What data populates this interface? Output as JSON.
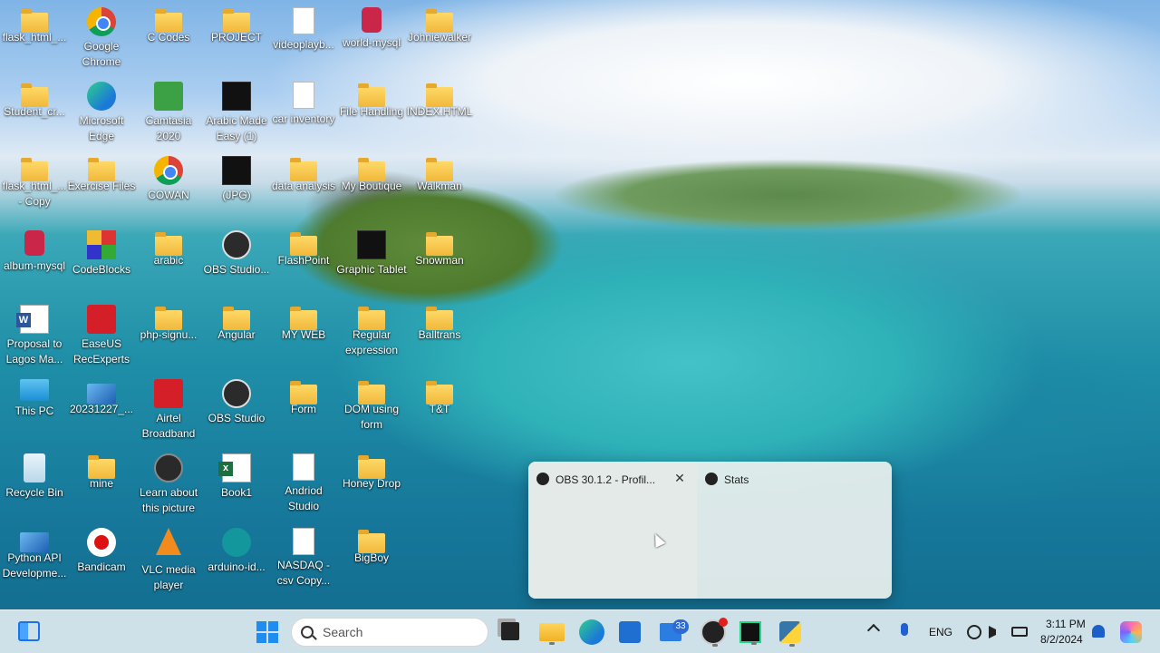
{
  "desktop": {
    "icons": [
      {
        "label": "flask_html_...",
        "icon": "folder-icon"
      },
      {
        "label": "Google Chrome",
        "icon": "chrome-icon"
      },
      {
        "label": "C Codes",
        "icon": "folder-icon"
      },
      {
        "label": "PROJECT",
        "icon": "folder-icon"
      },
      {
        "label": "videoplayb...",
        "icon": "file-icon"
      },
      {
        "label": "world-mysql",
        "icon": "database-icon"
      },
      {
        "label": "Johniewalker",
        "icon": "folder-icon"
      },
      {
        "label": "Student_cr...",
        "icon": "folder-icon"
      },
      {
        "label": "Microsoft Edge",
        "icon": "edge-icon"
      },
      {
        "label": "Camtasia 2020",
        "icon": "camtasia-icon"
      },
      {
        "label": "Arabic Made Easy (1)",
        "icon": "video-icon"
      },
      {
        "label": "car inventory",
        "icon": "file-icon"
      },
      {
        "label": "File Handling",
        "icon": "folder-icon"
      },
      {
        "label": "INDEX.HTML",
        "icon": "folder-icon"
      },
      {
        "label": "flask_html_... - Copy",
        "icon": "folder-icon"
      },
      {
        "label": "Exercise Files",
        "icon": "folder-icon"
      },
      {
        "label": "COWAN",
        "icon": "chrome-icon"
      },
      {
        "label": "(JPG)",
        "icon": "image-icon"
      },
      {
        "label": "data analysis",
        "icon": "folder-icon"
      },
      {
        "label": "My Boutique",
        "icon": "folder-icon"
      },
      {
        "label": "Walkman",
        "icon": "folder-icon"
      },
      {
        "label": "album-mysql",
        "icon": "database-icon"
      },
      {
        "label": "CodeBlocks",
        "icon": "codeblocks-icon"
      },
      {
        "label": "arabic",
        "icon": "folder-icon"
      },
      {
        "label": "OBS Studio...",
        "icon": "obs-icon"
      },
      {
        "label": "FlashPoint",
        "icon": "folder-icon"
      },
      {
        "label": "Graphic Tablet",
        "icon": "tablet-icon"
      },
      {
        "label": "Snowman",
        "icon": "folder-icon"
      },
      {
        "label": "Proposal to Lagos Ma...",
        "icon": "word-icon"
      },
      {
        "label": "EaseUS RecExperts",
        "icon": "recorder-icon"
      },
      {
        "label": "php-signu...",
        "icon": "folder-icon"
      },
      {
        "label": "Angular",
        "icon": "folder-icon"
      },
      {
        "label": "MY WEB",
        "icon": "folder-icon"
      },
      {
        "label": "Regular expression",
        "icon": "folder-icon"
      },
      {
        "label": "Balltrans",
        "icon": "folder-icon"
      },
      {
        "label": "This PC",
        "icon": "monitor-icon"
      },
      {
        "label": "20231227_...",
        "icon": "picture-icon"
      },
      {
        "label": "Airtel Broadband",
        "icon": "airtel-icon"
      },
      {
        "label": "OBS Studio",
        "icon": "obs-icon"
      },
      {
        "label": "Form",
        "icon": "folder-icon"
      },
      {
        "label": "DOM using form",
        "icon": "folder-icon"
      },
      {
        "label": "T&T",
        "icon": "folder-icon"
      },
      {
        "label": "Recycle Bin",
        "icon": "recycle-bin-icon"
      },
      {
        "label": "mine",
        "icon": "folder-icon"
      },
      {
        "label": "Learn about this picture",
        "icon": "camera-icon"
      },
      {
        "label": "Book1",
        "icon": "excel-icon"
      },
      {
        "label": "Andriod Studio",
        "icon": "file-icon"
      },
      {
        "label": "Honey Drop",
        "icon": "folder-icon"
      },
      {
        "label": "Python API Developme...",
        "icon": "python-folder-icon"
      },
      {
        "label": "Bandicam",
        "icon": "bandicam-icon"
      },
      {
        "label": "VLC media player",
        "icon": "vlc-icon"
      },
      {
        "label": "arduino-id...",
        "icon": "arduino-icon"
      },
      {
        "label": "NASDAQ - csv Copy...",
        "icon": "file-icon"
      },
      {
        "label": "BigBoy",
        "icon": "folder-icon"
      }
    ]
  },
  "popup": {
    "items": [
      {
        "title": "OBS 30.1.2 - Profil...",
        "close": "✕"
      },
      {
        "title": "Stats"
      }
    ]
  },
  "taskbar": {
    "search_placeholder": "Search",
    "mail_badge": "33",
    "language": "ENG",
    "time": "3:11 PM",
    "date": "8/2/2024"
  }
}
